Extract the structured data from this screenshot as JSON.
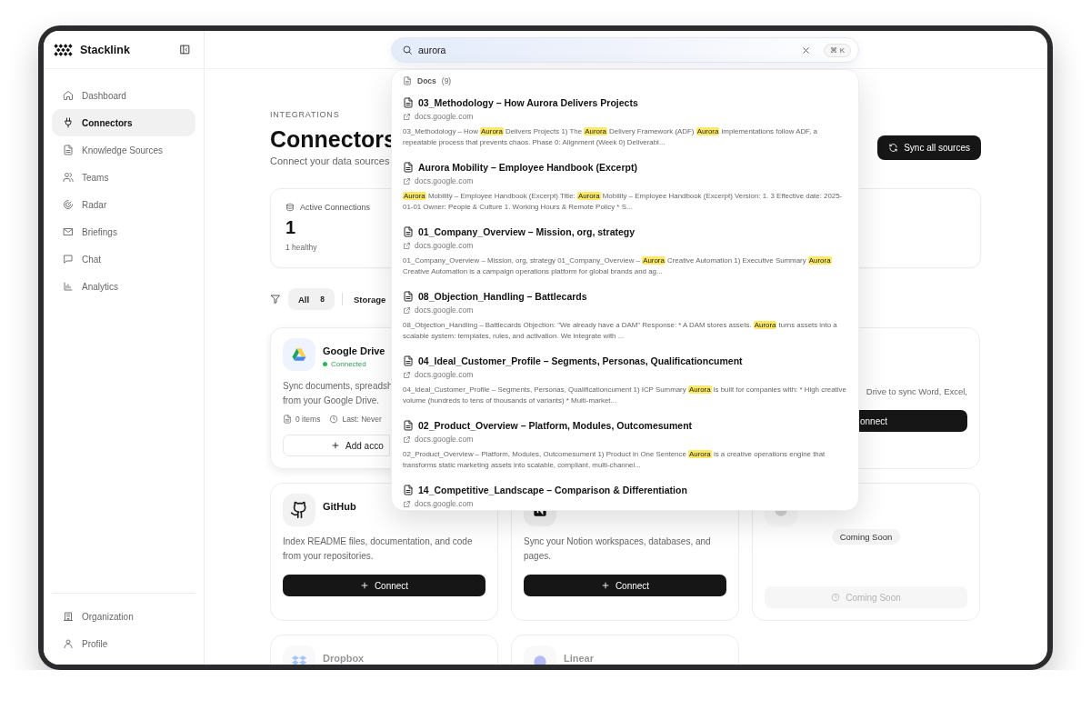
{
  "sidebar": {
    "brand": "Stacklink",
    "nav": [
      {
        "label": "Dashboard",
        "selected": false
      },
      {
        "label": "Connectors",
        "selected": true
      },
      {
        "label": "Knowledge Sources",
        "selected": false
      },
      {
        "label": "Teams",
        "selected": false
      },
      {
        "label": "Radar",
        "selected": false
      },
      {
        "label": "Briefings",
        "selected": false
      },
      {
        "label": "Chat",
        "selected": false
      },
      {
        "label": "Analytics",
        "selected": false
      }
    ],
    "footer": [
      {
        "label": "Organization"
      },
      {
        "label": "Profile"
      }
    ]
  },
  "page": {
    "eyebrow": "INTEGRATIONS",
    "title": "Connectors",
    "subtitle": "Connect your data sources",
    "sync_button": "Sync all sources"
  },
  "stats": [
    {
      "label": "Active Connections",
      "value": "1",
      "note": "1 healthy"
    }
  ],
  "filters": [
    {
      "label": "All",
      "count": "8",
      "selected": true
    },
    {
      "label": "Storage",
      "selected": false
    }
  ],
  "connectors": [
    {
      "name": "Google Drive",
      "status": "Connected",
      "description": [
        "Sync documents, spreadsh",
        "from your Google Drive."
      ],
      "meta": [
        "0 items",
        "Last: Never"
      ],
      "button": {
        "label": "Add acco",
        "kind": "outline"
      }
    },
    {
      "description": [
        "Drive to sync Word, Excel,"
      ],
      "button": {
        "label": "onnect",
        "kind": "primary"
      }
    },
    {
      "name": "GitHub",
      "description": [
        "Index README files, documentation, and code",
        "from your repositories."
      ],
      "button": {
        "label": "Connect",
        "kind": "primary"
      }
    },
    {
      "description": [
        "Sync your Notion workspaces, databases, and",
        "pages."
      ],
      "button": {
        "label": "Connect",
        "kind": "primary"
      }
    },
    {
      "badge": "Coming Soon",
      "button": {
        "label": "Coming Soon",
        "kind": "disabled"
      },
      "dimmed": true
    },
    {
      "name": "Dropbox",
      "dimmed": true
    },
    {
      "name": "Linear",
      "dimmed": true
    }
  ],
  "search": {
    "value": "aurora",
    "shortcut": "⌘ K",
    "group": {
      "label": "Docs",
      "count": "(9)"
    },
    "results": [
      {
        "title": "03_Methodology – How Aurora Delivers Projects",
        "source": "docs.google.com",
        "snippet": [
          {
            "text": "03_Methodology – How ",
            "highlight": false
          },
          {
            "text": "Aurora",
            "highlight": true
          },
          {
            "text": " Delivers Projects 1) The ",
            "highlight": false
          },
          {
            "text": "Aurora",
            "highlight": true
          },
          {
            "text": " Delivery Framework (ADF) ",
            "highlight": false
          },
          {
            "text": "Aurora",
            "highlight": true
          },
          {
            "text": " implementations follow ADF, a repeatable process that prevents chaos. Phase 0: Alignment (Week 0) Deliverabl...",
            "highlight": false
          }
        ]
      },
      {
        "title": "Aurora Mobility – Employee Handbook (Excerpt)",
        "source": "docs.google.com",
        "snippet": [
          {
            "text": "Aurora",
            "highlight": true
          },
          {
            "text": " Mobility – Employee Handbook (Excerpt) Title: ",
            "highlight": false
          },
          {
            "text": "Aurora",
            "highlight": true
          },
          {
            "text": " Mobility – Employee Handbook (Excerpt) Version: 1. 3 Effective date: 2025-01-01 Owner: People & Culture 1. Working Hours & Remote Policy * S...",
            "highlight": false
          }
        ]
      },
      {
        "title": "01_Company_Overview – Mission, org, strategy",
        "source": "docs.google.com",
        "snippet": [
          {
            "text": "01_Company_Overview – Mission, org, strategy 01_Company_Overview – ",
            "highlight": false
          },
          {
            "text": "Aurora",
            "highlight": true
          },
          {
            "text": " Creative Automation 1) Executive Summary ",
            "highlight": false
          },
          {
            "text": "Aurora",
            "highlight": true
          },
          {
            "text": " Creative Automation is a campaign operations platform for global brands and ag...",
            "highlight": false
          }
        ]
      },
      {
        "title": "08_Objection_Handling – Battlecards",
        "source": "docs.google.com",
        "snippet": [
          {
            "text": "08_Objection_Handling – Battlecards Objection: \"We already have a DAM\" Response: * A DAM stores assets. ",
            "highlight": false
          },
          {
            "text": "Aurora",
            "highlight": true
          },
          {
            "text": " turns assets into a scalable system: templates, rules, and activation. We integrate with ...",
            "highlight": false
          }
        ]
      },
      {
        "title": "04_Ideal_Customer_Profile – Segments, Personas, Qualificationcument",
        "source": "docs.google.com",
        "snippet": [
          {
            "text": "04_Ideal_Customer_Profile – Segments, Personas, Qualificationcument 1) ICP Summary ",
            "highlight": false
          },
          {
            "text": "Aurora",
            "highlight": true
          },
          {
            "text": " is built for companies with: * High creative volume (hundreds to tens of thousands of variants) * Multi-market...",
            "highlight": false
          }
        ]
      },
      {
        "title": "02_Product_Overview – Platform, Modules, Outcomesument",
        "source": "docs.google.com",
        "snippet": [
          {
            "text": "02_Product_Overview – Platform, Modules, Outcomesument 1) Product in One Sentence ",
            "highlight": false
          },
          {
            "text": "Aurora",
            "highlight": true
          },
          {
            "text": " is a creative operations engine that transforms static marketing assets into scalable, compliant, multi-channel...",
            "highlight": false
          }
        ]
      },
      {
        "title": "14_Competitive_Landscape – Comparison & Differentiation",
        "source": "docs.google.com"
      }
    ]
  }
}
